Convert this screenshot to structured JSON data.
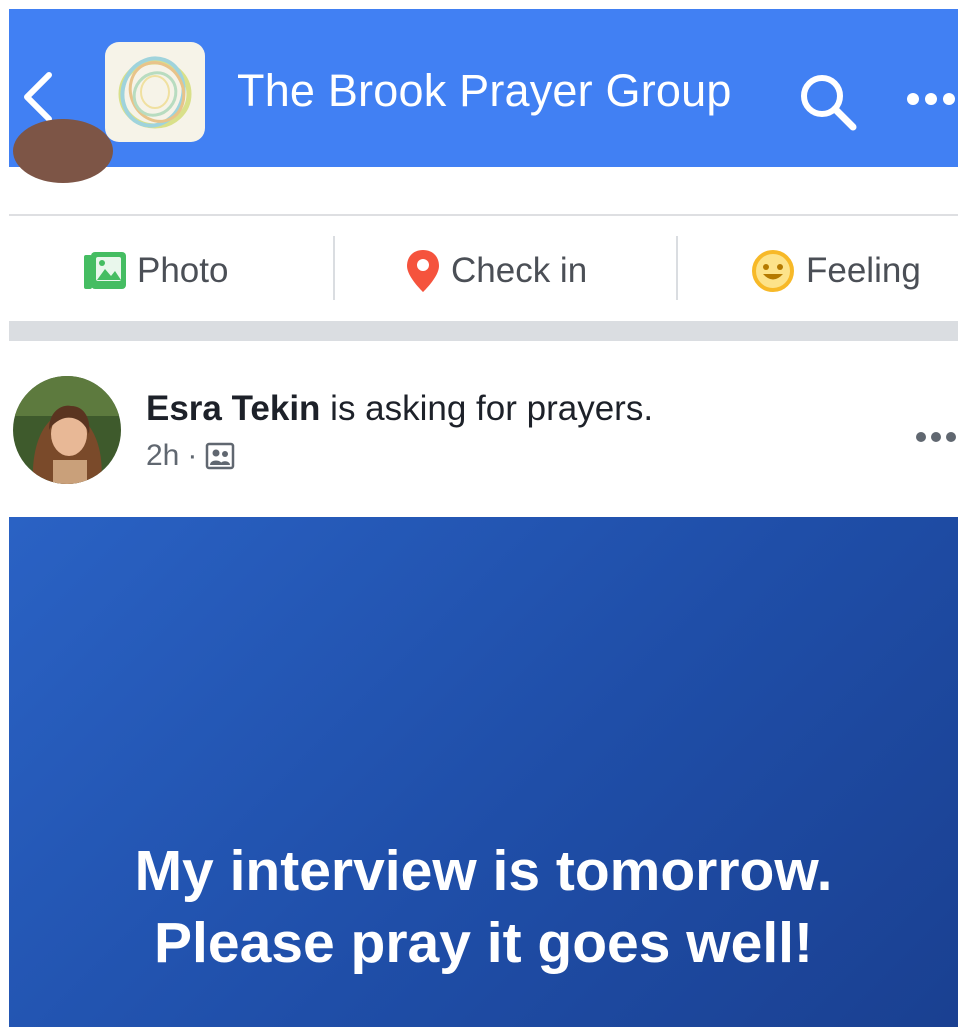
{
  "header": {
    "title": "The Brook Prayer Group",
    "background_color": "#4180f3",
    "back_icon": "chevron-left-icon",
    "logo_icon": "group-logo-icon",
    "search_icon": "search-icon",
    "more_icon": "more-horizontal-icon"
  },
  "composer": {
    "actions": [
      {
        "label": "Photo",
        "icon": "photo-icon",
        "color": "#45bd62"
      },
      {
        "label": "Check in",
        "icon": "location-pin-icon",
        "color": "#f5533d"
      },
      {
        "label": "Feeling",
        "icon": "smiley-icon",
        "color": "#f7b928"
      }
    ]
  },
  "post": {
    "author": "Esra Tekin",
    "action_text": " is asking for prayers.",
    "time": "2h",
    "separator": "·",
    "audience_icon": "group-members-icon",
    "more_icon": "more-horizontal-icon",
    "background_color": "#2355b3",
    "text_line1": "My interview is tomorrow.",
    "text_line2": "Please pray it goes well!"
  }
}
